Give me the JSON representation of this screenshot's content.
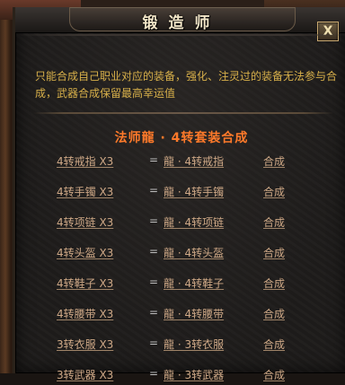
{
  "window": {
    "title": "锻造师",
    "close_label": "X"
  },
  "description": "只能合成自己职业对应的装备，强化、注灵过的装备无法参与合成，武器合成保留最高幸运值",
  "set_title": "法师龍 · 4转套装合成",
  "equals_sign": "=",
  "rows": [
    {
      "material": "4转戒指 X3",
      "result": "龍 · 4转戒指",
      "action": "合成"
    },
    {
      "material": "4转手镯 X3",
      "result": "龍 · 4转手镯",
      "action": "合成"
    },
    {
      "material": "4转项链 X3",
      "result": "龍 · 4转项链",
      "action": "合成"
    },
    {
      "material": "4转头盔 X3",
      "result": "龍 · 4转头盔",
      "action": "合成"
    },
    {
      "material": "4转鞋子 X3",
      "result": "龍 · 4转鞋子",
      "action": "合成"
    },
    {
      "material": "4转腰带 X3",
      "result": "龍 · 4转腰带",
      "action": "合成"
    },
    {
      "material": "3转衣服 X3",
      "result": "龍 · 3转衣服",
      "action": "合成"
    },
    {
      "material": "3转武器 X3",
      "result": "龍 · 3转武器",
      "action": "合成"
    }
  ],
  "colors": {
    "title": "#f2e6c8",
    "description": "#d8b04a",
    "set_title": "#ff7a2a",
    "row_text": "#cfa987"
  }
}
